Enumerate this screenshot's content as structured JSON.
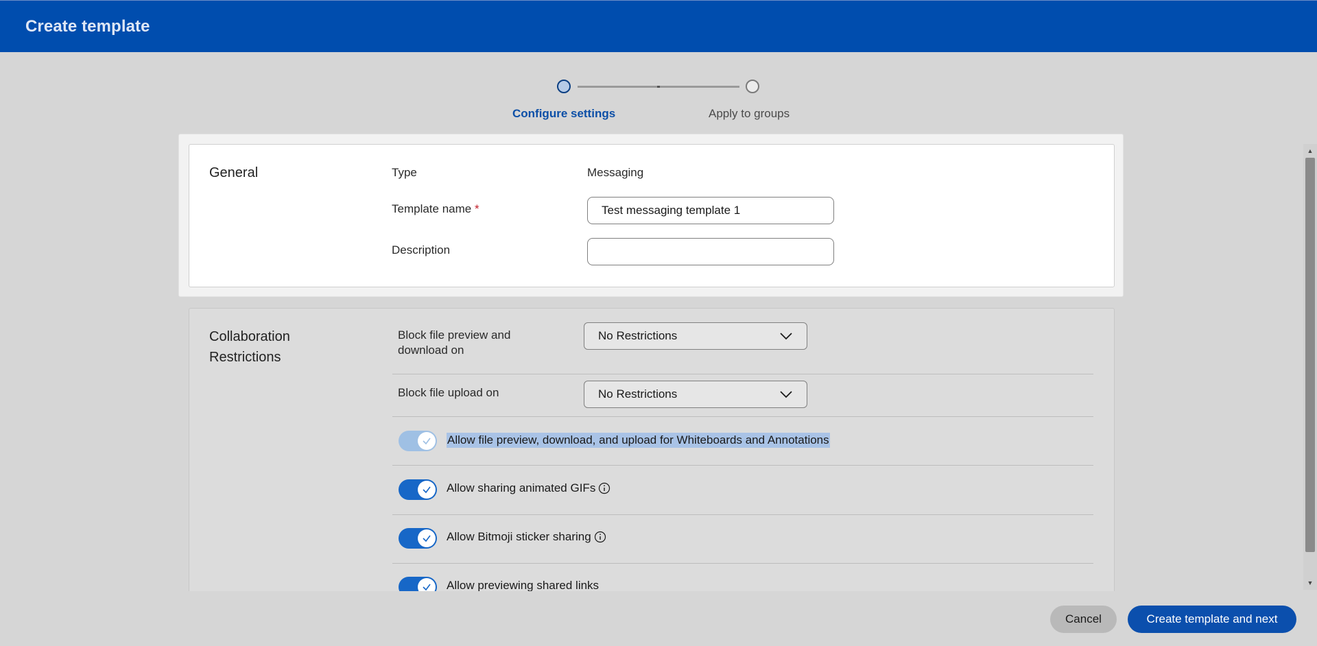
{
  "header": {
    "title": "Create template"
  },
  "stepper": {
    "steps": [
      {
        "label": "Configure settings",
        "state": "active"
      },
      {
        "label": "Apply to groups",
        "state": "inactive"
      }
    ]
  },
  "general": {
    "title": "General",
    "type_label": "Type",
    "type_value": "Messaging",
    "template_name_label": "Template name",
    "required_marker": "*",
    "template_name_value": "Test messaging template 1",
    "description_label": "Description",
    "description_value": ""
  },
  "collaboration": {
    "title_line1": "Collaboration",
    "title_line2": "Restrictions",
    "block_preview_label_line1": "Block file preview and",
    "block_preview_label_line2": "download on",
    "block_preview_value": "No Restrictions",
    "block_upload_label": "Block file upload on",
    "block_upload_value": "No Restrictions",
    "toggles": [
      {
        "label": "Allow file preview, download, and upload for Whiteboards and Annotations",
        "state": "on-disabled",
        "info": false
      },
      {
        "label": "Allow sharing animated GIFs",
        "state": "on",
        "info": true
      },
      {
        "label": "Allow Bitmoji sticker sharing",
        "state": "on",
        "info": true
      },
      {
        "label": "Allow previewing shared links",
        "state": "on",
        "info": false
      }
    ]
  },
  "footer": {
    "cancel_label": "Cancel",
    "primary_label": "Create template and next"
  },
  "colors": {
    "header_bg": "#004dae",
    "primary": "#0b4fad",
    "toggle_on": "#1767c7",
    "toggle_disabled": "#9fc0e4",
    "required": "#c21f2a",
    "highlight": "#a9c3e6"
  }
}
